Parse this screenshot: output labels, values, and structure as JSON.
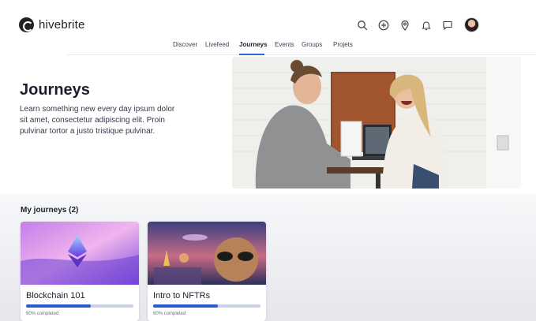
{
  "app": {
    "logo_text": "hivebrite"
  },
  "header_icons": [
    "search-icon",
    "add-circle-icon",
    "location-pin-icon",
    "bell-icon",
    "chat-icon"
  ],
  "nav": {
    "items": [
      {
        "label": "Discover"
      },
      {
        "label": "Livefeed"
      },
      {
        "label": "Journeys",
        "active": true
      },
      {
        "label": "Events"
      },
      {
        "label": "Groups"
      },
      {
        "label": "Projets"
      }
    ]
  },
  "hero": {
    "title": "Journeys",
    "description": "Learn something new every day ipsum dolor sit amet, consectetur adipiscing elit. Proin pulvinar tortor a justo tristique pulvinar."
  },
  "journeys": {
    "heading": "My journeys (2)",
    "cards": [
      {
        "title": "Blockchain 101",
        "progress": 0.6,
        "progress_text": "60% completed"
      },
      {
        "title": "Intro to NFTRs",
        "progress": 0.6,
        "progress_text": "60% completed"
      }
    ]
  },
  "colors": {
    "accent": "#2a5bd7",
    "nav_underline": "#2a6ad6"
  }
}
